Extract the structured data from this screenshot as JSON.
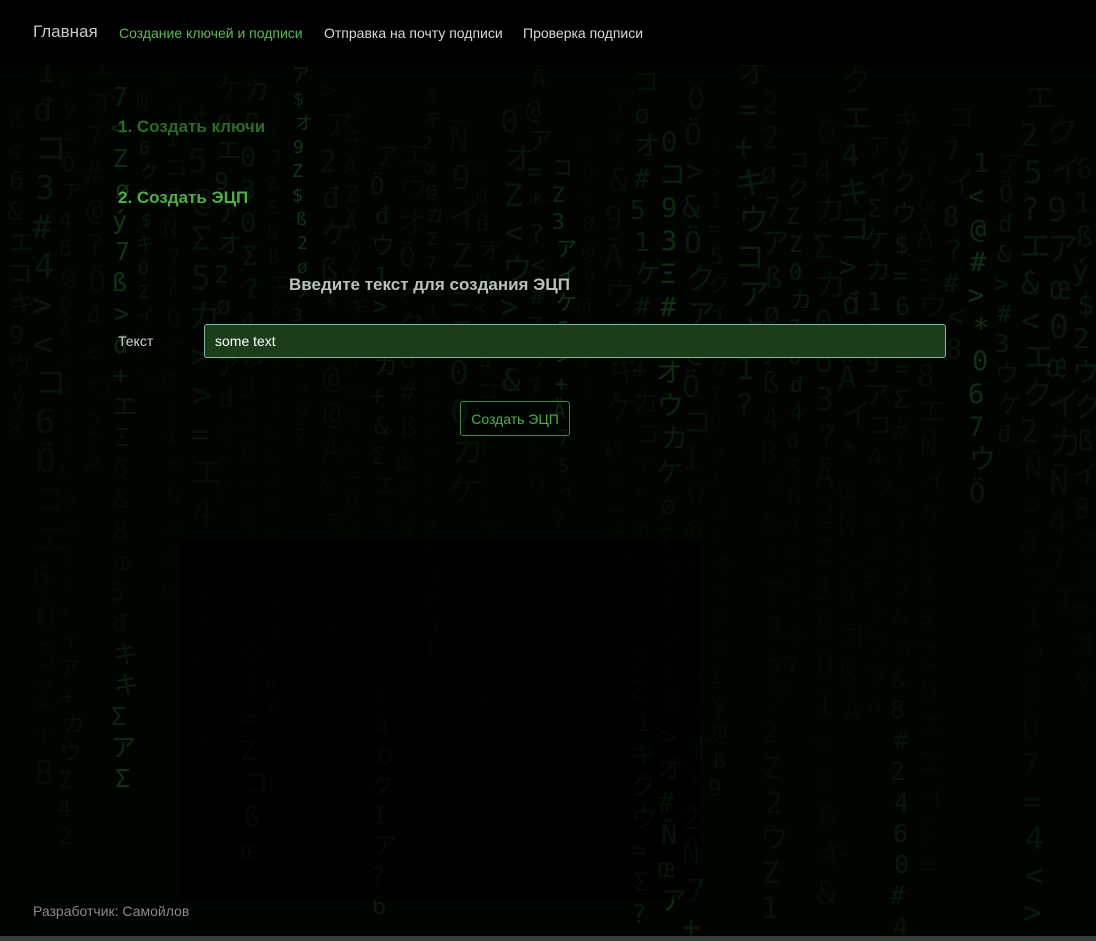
{
  "navbar": {
    "brand": "Главная",
    "links": [
      {
        "label": "Создание ключей и подписи",
        "active": true
      },
      {
        "label": "Отправка на почту подписи",
        "active": false
      },
      {
        "label": "Проверка подписи",
        "active": false
      }
    ]
  },
  "steps": {
    "create_keys": "1. Создать ключи",
    "create_signature": "2. Создать ЭЦП"
  },
  "form": {
    "title": "Введите текст для создания ЭЦП",
    "text_label": "Текст",
    "text_value": "some text",
    "submit_label": "Создать ЭЦП"
  },
  "footer": {
    "developer": "Разработчик: Самойлов"
  },
  "colors": {
    "accent": "#4fb04a",
    "background": "#020402",
    "input_bg": "#1c3c1a"
  }
}
